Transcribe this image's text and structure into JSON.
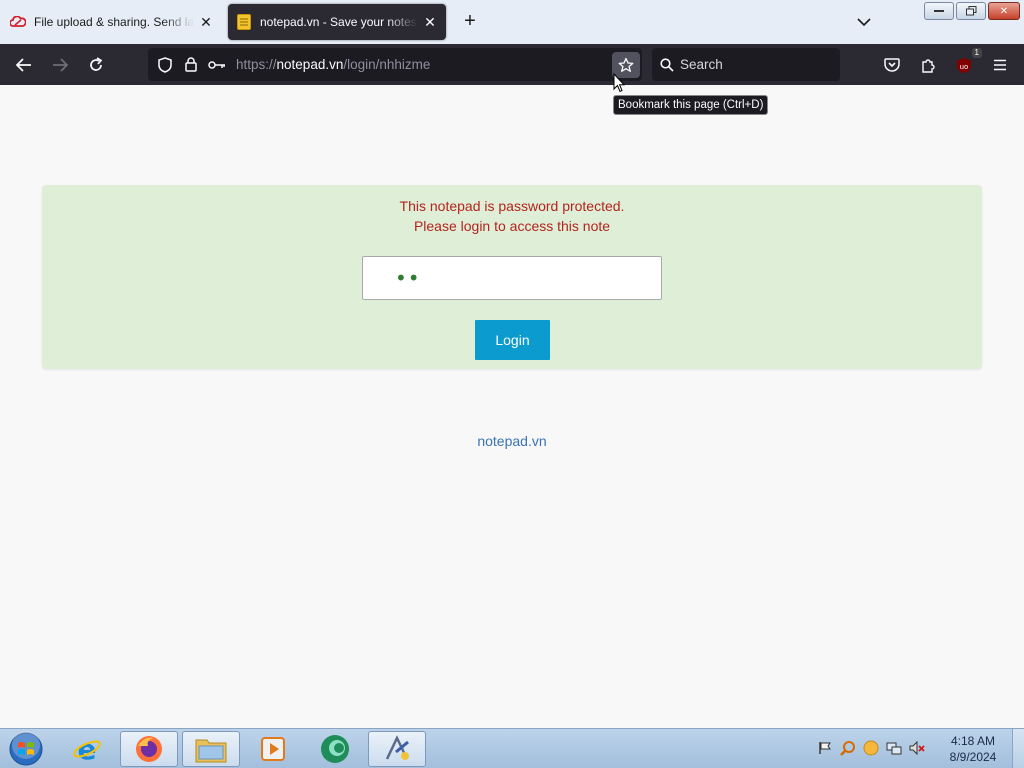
{
  "browser": {
    "tabs": [
      {
        "title": "File upload & sharing. Send large files",
        "favicon": "cloud-icon"
      },
      {
        "title": "notepad.vn - Save your notes, share your notes",
        "favicon": "notepad-icon"
      }
    ],
    "url": {
      "scheme": "https://",
      "host": "notepad.vn",
      "path": "/login/nhhizme"
    },
    "search_placeholder": "Search",
    "extension_badge": "1",
    "tooltip": "Bookmark this page (Ctrl+D)"
  },
  "page": {
    "message_line1": "This notepad is password protected.",
    "message_line2": "Please login to access this note",
    "password_masked": "••",
    "login_button": "Login",
    "footer_link": "notepad.vn",
    "colors": {
      "panel_bg": "#dfeed6",
      "message": "#b3241e",
      "button": "#0b9bce",
      "link": "#3a74b5"
    }
  },
  "taskbar": {
    "apps": [
      "internet-explorer",
      "firefox",
      "file-explorer",
      "media-player",
      "app-green-circle",
      "app-tool"
    ],
    "clock_time": "4:18 AM",
    "clock_date": "8/9/2024"
  }
}
